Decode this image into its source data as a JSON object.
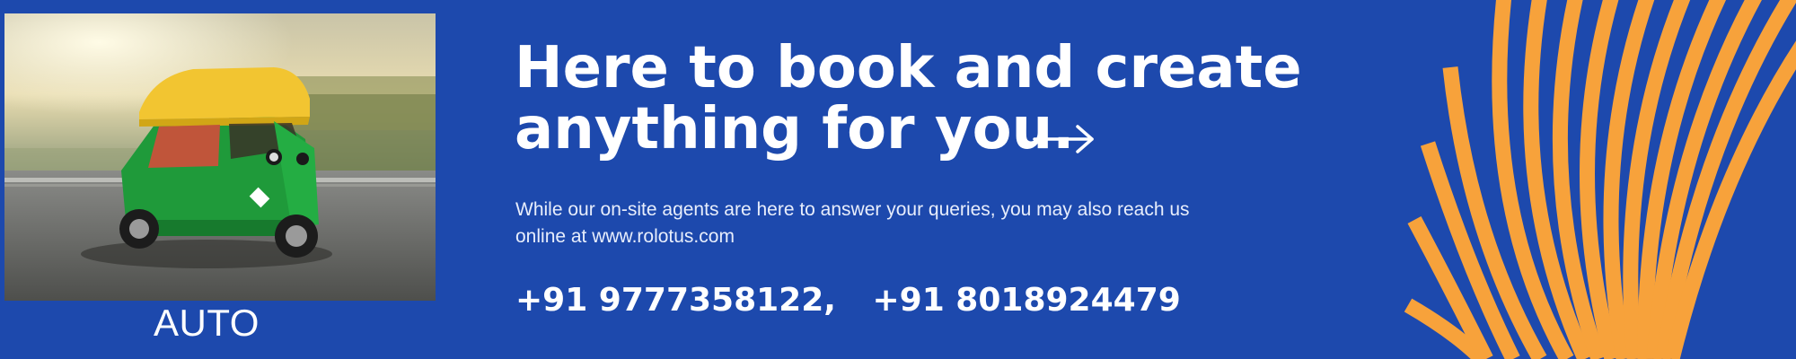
{
  "colors": {
    "background": "#1d49ad",
    "accent_orange": "#f7a23b",
    "text": "#ffffff"
  },
  "photo": {
    "icon": "auto-rickshaw-photo",
    "caption": "AUTO"
  },
  "headline": {
    "line1": "Here to book and create",
    "line2": "anything for you."
  },
  "arrow_icon": "arrow-right-icon",
  "body_text": "While our on-site agents are here to answer your queries, you may also reach us online at www.rolotus.com",
  "phones": {
    "first": "+91 9777358122,",
    "second": "+91 8018924479"
  },
  "decoration": "orange-swirl-lines"
}
